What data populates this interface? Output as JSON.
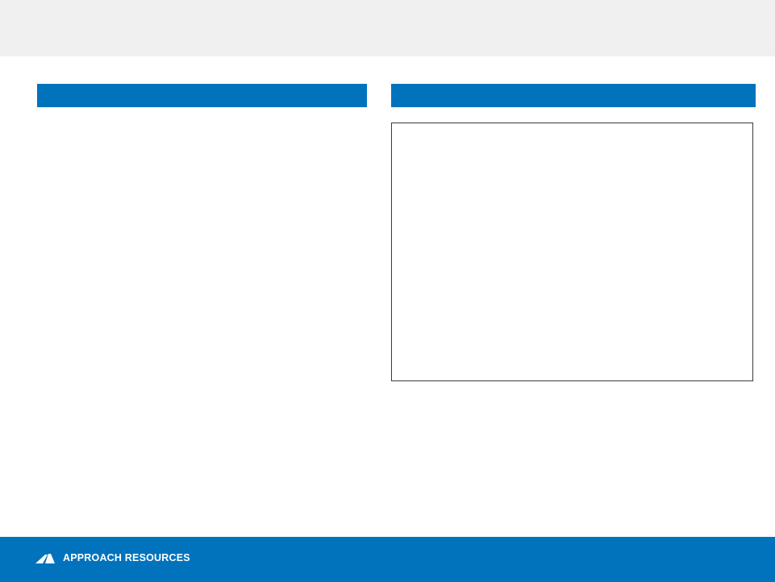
{
  "colors": {
    "accent": "#0073bc",
    "top_band": "#f0f0f1",
    "background": "#ffffff"
  },
  "footer": {
    "logo_icon": "approach-resources-logo-icon",
    "company_name": "APPROACH RESOURCES"
  }
}
